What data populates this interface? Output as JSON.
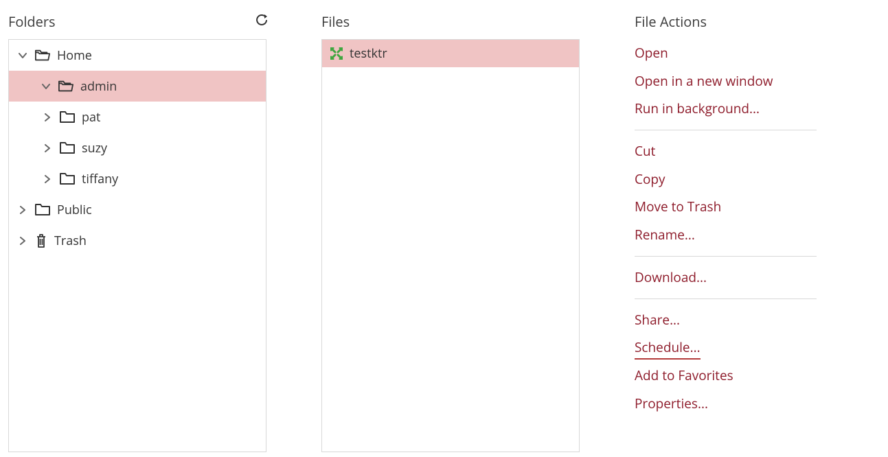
{
  "folders": {
    "title": "Folders",
    "tree": {
      "home": {
        "label": "Home",
        "expanded": true
      },
      "admin": {
        "label": "admin",
        "expanded": true
      },
      "pat": {
        "label": "pat",
        "expanded": false
      },
      "suzy": {
        "label": "suzy",
        "expanded": false
      },
      "tiffany": {
        "label": "tiffany",
        "expanded": false
      },
      "public": {
        "label": "Public",
        "expanded": false
      },
      "trash": {
        "label": "Trash",
        "expanded": false
      }
    },
    "selected": "admin"
  },
  "files": {
    "title": "Files",
    "items": [
      {
        "name": "testktr",
        "type": "ktr",
        "selected": true
      }
    ]
  },
  "actions": {
    "title": "File Actions",
    "groups": [
      [
        "Open",
        "Open in a new window",
        "Run in background..."
      ],
      [
        "Cut",
        "Copy",
        "Move to Trash",
        "Rename..."
      ],
      [
        "Download..."
      ],
      [
        "Share...",
        "Schedule...",
        "Add to Favorites",
        "Properties..."
      ]
    ],
    "underlined": "Schedule..."
  }
}
